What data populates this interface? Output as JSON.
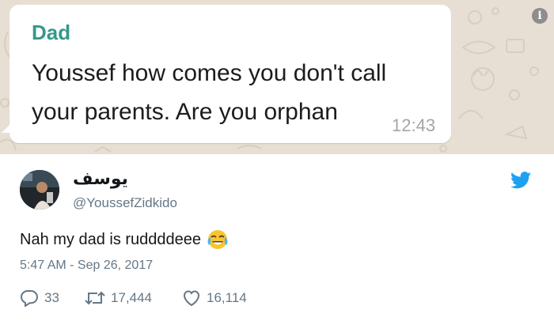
{
  "whatsapp": {
    "sender": "Dad",
    "message_line1": "Youssef how comes you don't call",
    "message_line2": "your parents. Are you orphan",
    "time": "12:43",
    "info_icon": "info-icon",
    "colors": {
      "background": "#e7dfd4",
      "sender": "#35988a",
      "bubble": "#ffffff"
    }
  },
  "tweet": {
    "display_name": "يوسف",
    "handle": "@YoussefZidkido",
    "text": "Nah my dad is ruddddeee",
    "emoji": "face-with-tears-of-joy",
    "timestamp": "5:47 AM - Sep 26, 2017",
    "brand_icon": "twitter-bird-icon",
    "actions": {
      "replies": "33",
      "retweets": "17,444",
      "likes": "16,114"
    },
    "colors": {
      "brand": "#1da1f2",
      "secondary": "#657786",
      "text": "#14171a"
    }
  }
}
